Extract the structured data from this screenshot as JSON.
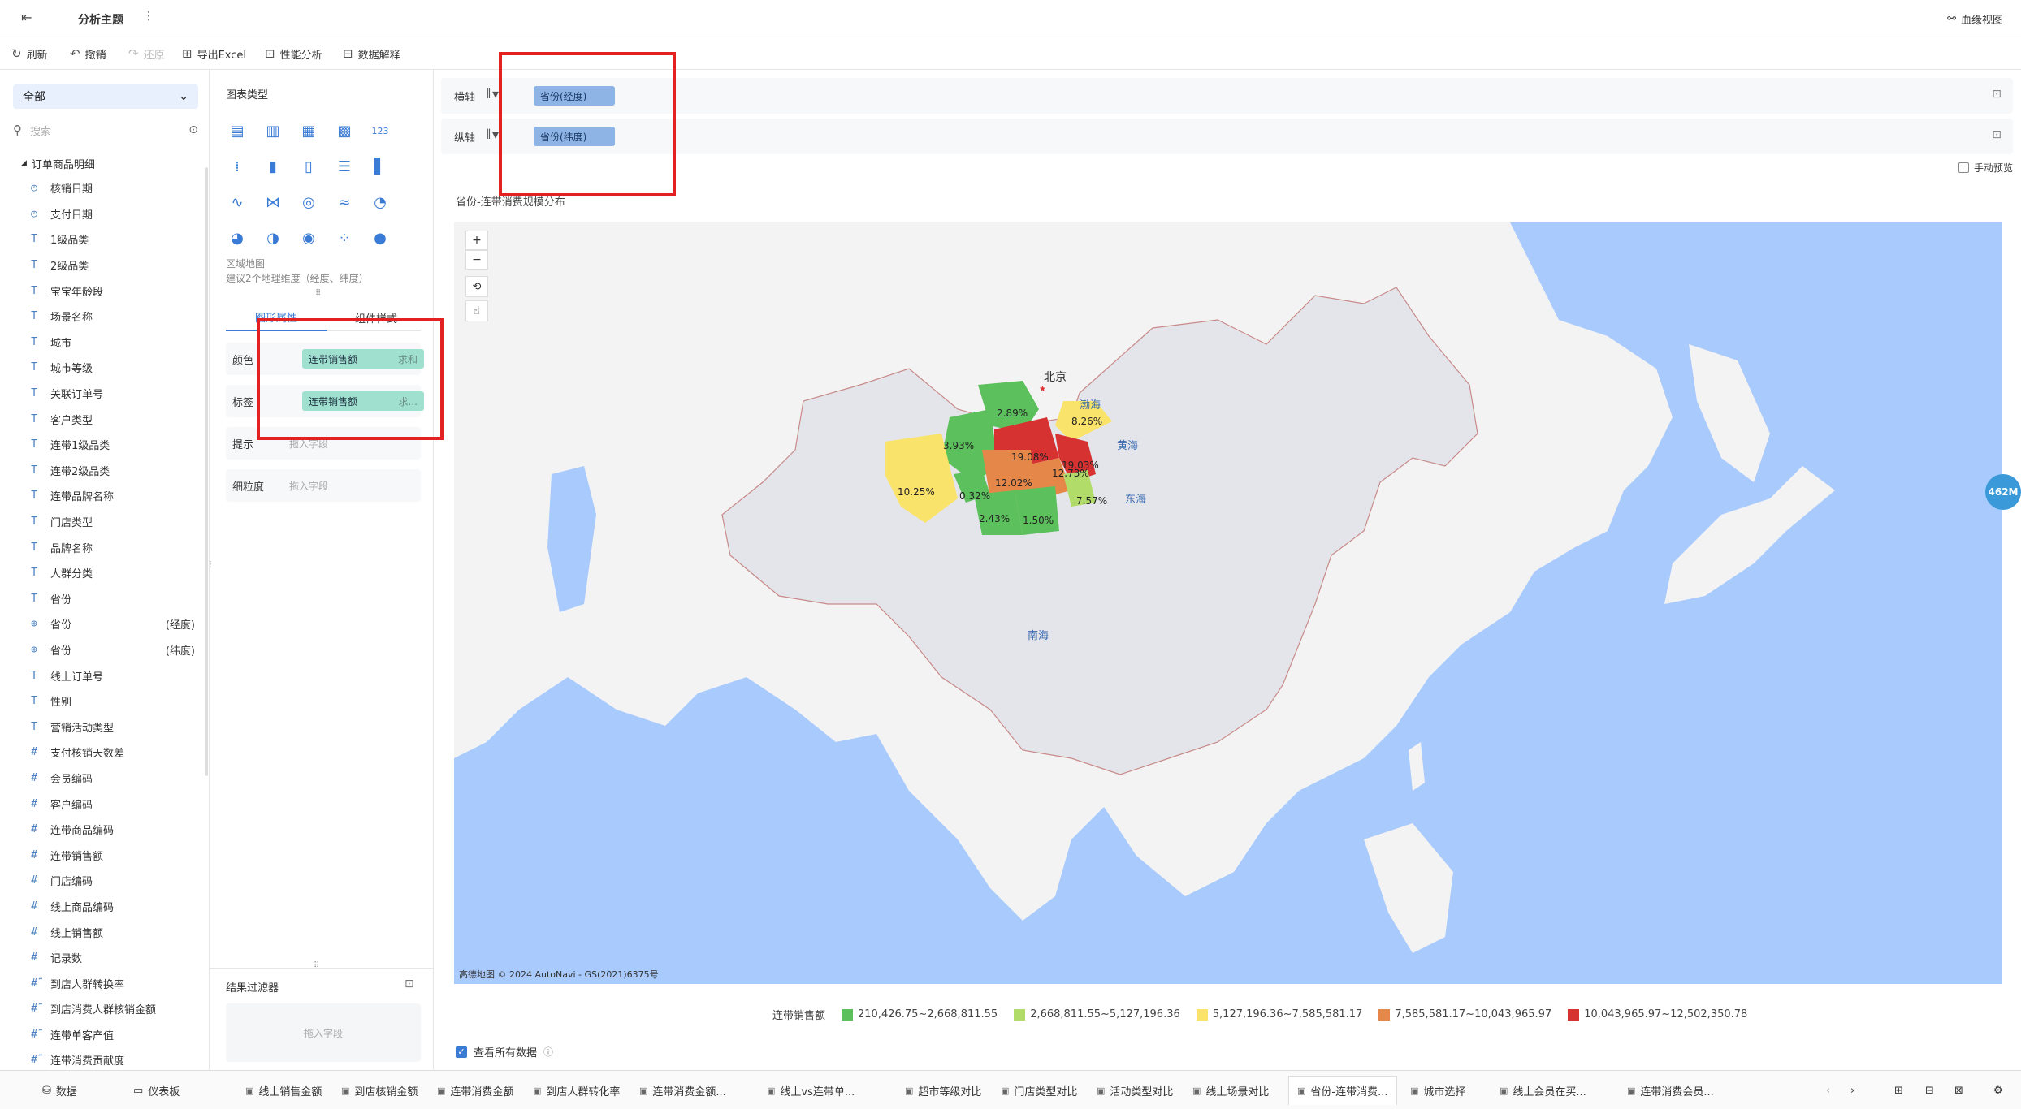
{
  "topbar": {
    "title": "分析主题",
    "more": "⋮",
    "right_link": "血缘视图"
  },
  "toolbar": {
    "refresh": "刷新",
    "undo": "撤销",
    "redo": "还原",
    "export": "导出Excel",
    "perf": "性能分析",
    "explain": "数据解释"
  },
  "left": {
    "select": "全部",
    "search_placeholder": "搜索",
    "group": "订单商品明细",
    "fields": [
      {
        "icon": "◷",
        "label": "核销日期"
      },
      {
        "icon": "◷",
        "label": "支付日期"
      },
      {
        "icon": "T",
        "label": "1级品类"
      },
      {
        "icon": "T",
        "label": "2级品类"
      },
      {
        "icon": "T",
        "label": "宝宝年龄段"
      },
      {
        "icon": "T",
        "label": "场景名称"
      },
      {
        "icon": "T",
        "label": "城市"
      },
      {
        "icon": "T",
        "label": "城市等级"
      },
      {
        "icon": "T",
        "label": "关联订单号"
      },
      {
        "icon": "T",
        "label": "客户类型"
      },
      {
        "icon": "T",
        "label": "连带1级品类"
      },
      {
        "icon": "T",
        "label": "连带2级品类"
      },
      {
        "icon": "T",
        "label": "连带品牌名称"
      },
      {
        "icon": "T",
        "label": "门店类型"
      },
      {
        "icon": "T",
        "label": "品牌名称"
      },
      {
        "icon": "T",
        "label": "人群分类"
      },
      {
        "icon": "T",
        "label": "省份"
      },
      {
        "icon": "⊕",
        "label": "省份",
        "suffix": "(经度)"
      },
      {
        "icon": "⊕",
        "label": "省份",
        "suffix": "(纬度)"
      },
      {
        "icon": "T",
        "label": "线上订单号"
      },
      {
        "icon": "T",
        "label": "性别"
      },
      {
        "icon": "T",
        "label": "营销活动类型"
      },
      {
        "icon": "#",
        "label": "支付核销天数差"
      },
      {
        "icon": "#",
        "label": "会员编码"
      },
      {
        "icon": "#",
        "label": "客户编码"
      },
      {
        "icon": "#",
        "label": "连带商品编码"
      },
      {
        "icon": "#",
        "label": "连带销售额"
      },
      {
        "icon": "#",
        "label": "门店编码"
      },
      {
        "icon": "#",
        "label": "线上商品编码"
      },
      {
        "icon": "#",
        "label": "线上销售额"
      },
      {
        "icon": "#",
        "label": "记录数"
      },
      {
        "icon": "#̃",
        "label": "到店人群转换率"
      },
      {
        "icon": "#̃",
        "label": "到店消费人群核销金额"
      },
      {
        "icon": "#̃",
        "label": "连带单客产值"
      },
      {
        "icon": "#̃",
        "label": "连带消费贡献度"
      }
    ]
  },
  "mid": {
    "chart_type_title": "图表类型",
    "chart_hint_name": "区域地图",
    "chart_hint_desc": "建议2个地理维度（经度、纬度）",
    "tab_graph": "图形属性",
    "tab_style": "组件样式",
    "color_label": "颜色",
    "color_field": "连带销售额",
    "color_agg": "求和",
    "label_label": "标签",
    "label_field": "连带销售额",
    "label_agg": "求...",
    "tooltip_label": "提示",
    "tooltip_placeholder": "拖入字段",
    "granularity_label": "细粒度",
    "granularity_placeholder": "拖入字段",
    "filter_title": "结果过滤器",
    "filter_placeholder": "拖入字段"
  },
  "main": {
    "x_axis_label": "横轴",
    "x_axis_field": "省份(经度)",
    "y_axis_label": "纵轴",
    "y_axis_field": "省份(纬度)",
    "manual_preview": "手动预览",
    "chart_title": "省份-连带消费规模分布",
    "map_labels": {
      "beijing": "北京",
      "bohai": "渤海",
      "huanghai": "黄海",
      "donghai": "东海",
      "nanhai": "南海"
    },
    "zoom_badge": "462M",
    "attribution": "高德地图 © 2024 AutoNavi - GS(2021)6375号",
    "show_all": "查看所有数据"
  },
  "chart_data": {
    "type": "choropleth-map",
    "title": "省份-连带消费规模分布",
    "measure": "连带销售额",
    "legend": [
      {
        "label": "210,426.75~2,668,811.55",
        "color": "#5cc05c"
      },
      {
        "label": "2,668,811.55~5,127,196.36",
        "color": "#b2dc6a"
      },
      {
        "label": "5,127,196.36~7,585,581.17",
        "color": "#fae36a"
      },
      {
        "label": "7,585,581.17~10,043,965.97",
        "color": "#e6874a"
      },
      {
        "label": "10,043,965.97~12,502,350.78",
        "color": "#d63232"
      }
    ],
    "region_labels": [
      {
        "value": "2.89%",
        "bin": 0
      },
      {
        "value": "8.26%",
        "bin": 2
      },
      {
        "value": "3.93%",
        "bin": 0
      },
      {
        "value": "19.08%",
        "bin": 4
      },
      {
        "value": "12.73%",
        "bin": 3
      },
      {
        "value": "19.03%",
        "bin": 4
      },
      {
        "value": "10.25%",
        "bin": 2
      },
      {
        "value": "0.32%",
        "bin": 0
      },
      {
        "value": "12.02%",
        "bin": 3
      },
      {
        "value": "7.57%",
        "bin": 1
      },
      {
        "value": "2.43%",
        "bin": 0
      },
      {
        "value": "1.50%",
        "bin": 0
      }
    ]
  },
  "bottom": {
    "data": "数据",
    "dashboard": "仪表板",
    "tabs": [
      "线上销售金额",
      "到店核销金额",
      "连带消费金额",
      "到店人群转化率",
      "连带消费金额...",
      "线上vs连带单...",
      "超市等级对比",
      "门店类型对比",
      "活动类型对比",
      "线上场景对比",
      "省份-连带消费...",
      "城市选择",
      "线上会员在买...",
      "连带消费会员..."
    ],
    "active_index": 10
  },
  "colors": {
    "accent": "#3a7bd5",
    "highlight_box": "#e32121",
    "sea": "#a9cafc",
    "land": "#f3f3f3",
    "china": "#e3e5ea"
  }
}
